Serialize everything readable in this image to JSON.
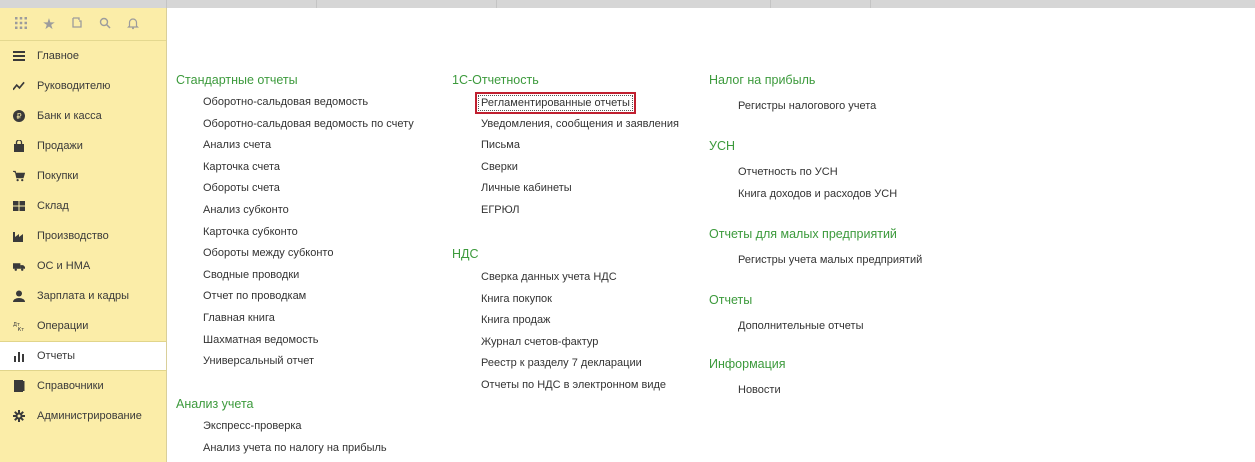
{
  "sidebar": {
    "toolbar": [
      "apps-grid-icon",
      "star-icon",
      "history-icon",
      "search-icon",
      "bell-icon"
    ],
    "items": [
      {
        "label": "Главное",
        "icon": "menu-icon"
      },
      {
        "label": "Руководителю",
        "icon": "trend-icon"
      },
      {
        "label": "Банк и касса",
        "icon": "ruble-icon"
      },
      {
        "label": "Продажи",
        "icon": "bag-icon"
      },
      {
        "label": "Покупки",
        "icon": "cart-icon"
      },
      {
        "label": "Склад",
        "icon": "warehouse-icon"
      },
      {
        "label": "Производство",
        "icon": "factory-icon"
      },
      {
        "label": "ОС и НМА",
        "icon": "truck-icon"
      },
      {
        "label": "Зарплата и кадры",
        "icon": "person-icon"
      },
      {
        "label": "Операции",
        "icon": "dt-kt-icon"
      },
      {
        "label": "Отчеты",
        "icon": "chart-icon",
        "active": true
      },
      {
        "label": "Справочники",
        "icon": "book-icon"
      },
      {
        "label": "Администрирование",
        "icon": "gear-icon"
      }
    ]
  },
  "columns": {
    "col1": {
      "sections": [
        {
          "title": "Стандартные отчеты",
          "links": [
            "Оборотно-сальдовая ведомость",
            "Оборотно-сальдовая ведомость по счету",
            "Анализ счета",
            "Карточка счета",
            "Обороты счета",
            "Анализ субконто",
            "Карточка субконто",
            "Обороты между субконто",
            "Сводные проводки",
            "Отчет по проводкам",
            "Главная книга",
            "Шахматная ведомость",
            "Универсальный отчет"
          ]
        },
        {
          "title": "Анализ учета",
          "links": [
            "Экспресс-проверка",
            "Анализ учета по налогу на прибыль"
          ]
        }
      ]
    },
    "col2": {
      "sections": [
        {
          "title": "1С-Отчетность",
          "links": [
            "Регламентированные отчеты",
            "Уведомления, сообщения и заявления",
            "Письма",
            "Сверки",
            "Личные кабинеты",
            "ЕГРЮЛ"
          ]
        },
        {
          "title": "НДС",
          "links": [
            "Сверка данных учета НДС",
            "Книга покупок",
            "Книга продаж",
            "Журнал счетов-фактур",
            "Реестр к разделу 7 декларации",
            "Отчеты по НДС в электронном виде"
          ]
        }
      ]
    },
    "col3": {
      "sections": [
        {
          "title": "Налог на прибыль",
          "links": [
            "Регистры налогового учета"
          ]
        },
        {
          "title": "УСН",
          "links": [
            "Отчетность по УСН",
            "Книга доходов и расходов УСН"
          ]
        },
        {
          "title": "Отчеты для малых предприятий",
          "links": [
            "Регистры учета малых предприятий"
          ]
        },
        {
          "title": "Отчеты",
          "links": [
            "Дополнительные отчеты"
          ]
        },
        {
          "title": "Информация",
          "links": [
            "Новости"
          ]
        }
      ]
    }
  },
  "colors": {
    "sidebar_bg": "#fbeda8",
    "section_title": "#3c9a3c",
    "highlight_box": "#c01f2f"
  }
}
